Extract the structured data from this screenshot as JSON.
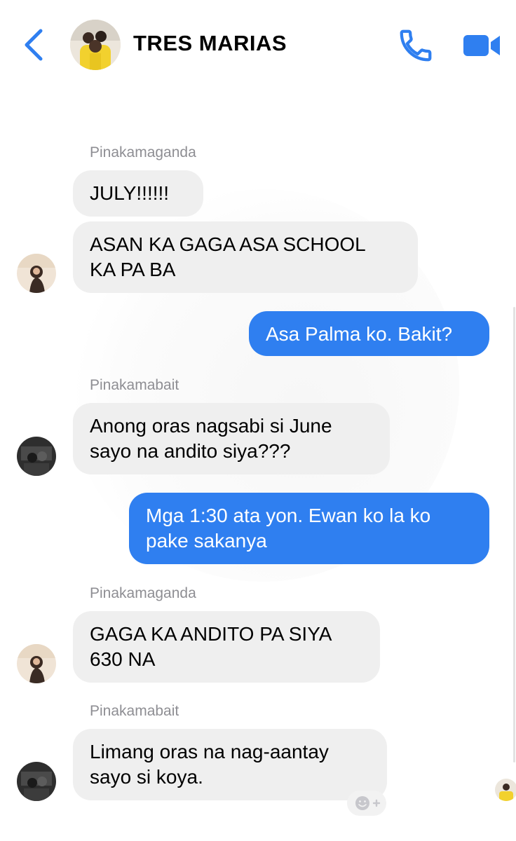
{
  "header": {
    "title": "TRES MARIAS",
    "back_icon": "chevron-left-icon",
    "call_icon": "phone-icon",
    "video_icon": "video-camera-icon",
    "accent_color": "#2f7ff0"
  },
  "messages": [
    {
      "sender": "Pinakamaganda",
      "text_lines": [
        "JULY!!!!!!"
      ],
      "direction": "incoming"
    },
    {
      "sender": "Pinakamaganda",
      "text_lines": [
        "ASAN KA GAGA ASA SCHOOL",
        "KA PA BA"
      ],
      "direction": "incoming"
    },
    {
      "text_lines": [
        "Asa Palma ko. Bakit?"
      ],
      "direction": "outgoing"
    },
    {
      "sender": "Pinakamabait",
      "text_lines": [
        "Anong oras nagsabi si June",
        "sayo na andito siya???"
      ],
      "direction": "incoming"
    },
    {
      "text_lines": [
        "Mga 1:30 ata yon. Ewan ko la ko",
        "pake sakanya"
      ],
      "direction": "outgoing"
    },
    {
      "sender": "Pinakamaganda",
      "text_lines": [
        "GAGA KA ANDITO PA SIYA",
        "630 NA"
      ],
      "direction": "incoming"
    },
    {
      "sender": "Pinakamabait",
      "text_lines": [
        "Limang oras na nag-aantay",
        "sayo si koya."
      ],
      "direction": "incoming"
    }
  ],
  "sender_labels": [
    "Pinakamaganda",
    "Pinakamabait",
    "Pinakamaganda",
    "Pinakamabait"
  ],
  "reaction_icon": "smiley-plus-icon",
  "colors": {
    "incoming_bubble": "#efefef",
    "outgoing_bubble": "#2f7ff0",
    "sender_label": "#8e8e93"
  }
}
